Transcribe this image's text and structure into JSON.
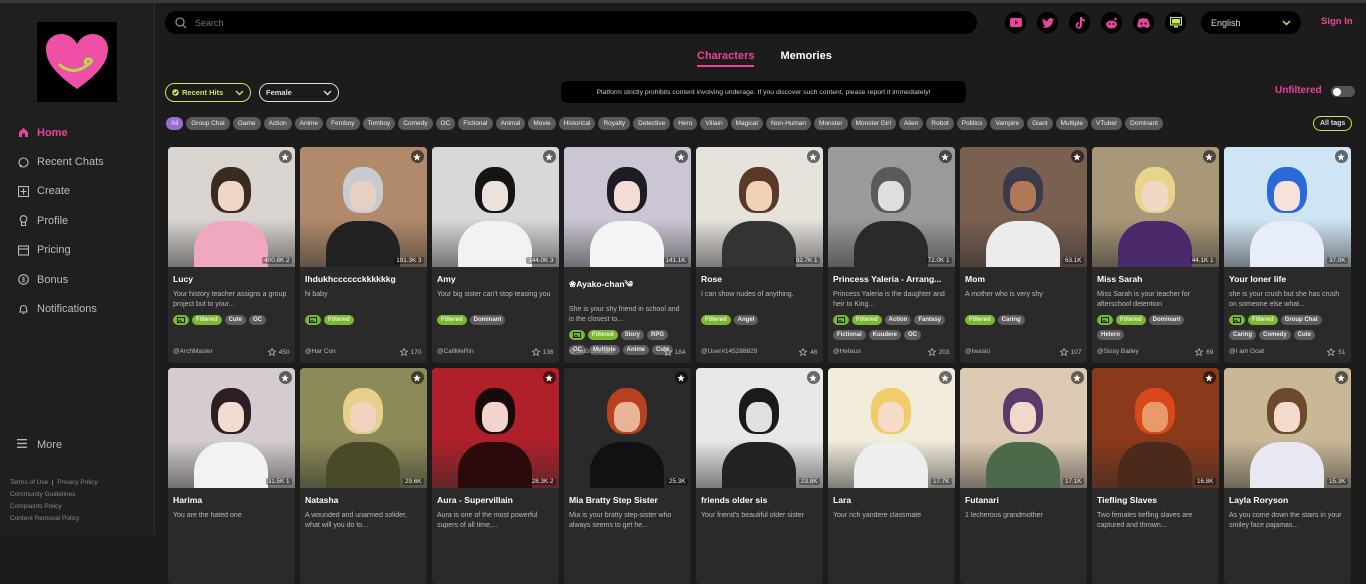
{
  "sidebar": {
    "nav": [
      {
        "label": "Home",
        "icon": "home-icon",
        "active": true
      },
      {
        "label": "Recent Chats",
        "icon": "chat-icon"
      },
      {
        "label": "Create",
        "icon": "plus-square-icon"
      },
      {
        "label": "Profile",
        "icon": "profile-icon"
      },
      {
        "label": "Pricing",
        "icon": "pricing-icon"
      },
      {
        "label": "Bonus",
        "icon": "coin-icon"
      },
      {
        "label": "Notifications",
        "icon": "bell-icon"
      }
    ],
    "more_label": "More",
    "footer": {
      "terms": "Terms of Use",
      "privacy": "Privacy Policy",
      "guidelines": "Community Guidelines",
      "complaints": "Complaints Policy",
      "removal": "Content Removal Policy"
    }
  },
  "search": {
    "placeholder": "Search"
  },
  "language": "English",
  "signin": "Sign In",
  "tabs": {
    "characters": "Characters",
    "memories": "Memories"
  },
  "filters": {
    "sort": "Recent Hits",
    "gender": "Female"
  },
  "notice": "Platform strictly prohibits content involving underage. If you discover such content, please report it immediately!",
  "unfiltered_label": "Unfiltered",
  "tags": [
    "All",
    "Group Chat",
    "Game",
    "Action",
    "Anime",
    "Femboy",
    "Tomboy",
    "Comedy",
    "OC",
    "Fictional",
    "Animal",
    "Movie",
    "Historical",
    "Royalty",
    "Detective",
    "Hero",
    "Villain",
    "Magical",
    "Non-Human",
    "Monster",
    "Monster Girl",
    "Alien",
    "Robot",
    "Politics",
    "Vampire",
    "Giant",
    "Multiple",
    "VTuber",
    "Dominant"
  ],
  "all_tags_label": "All tags",
  "colors": {
    "accent": "#e8459a",
    "green": "#c4e85a",
    "tag_green": "#7cb82f"
  },
  "cards": [
    {
      "name": "Lucy",
      "desc": "Your history teacher assigns a group project but to your...",
      "stats": "400.8K  2",
      "tags": [
        "img",
        "Filtered",
        "Cute",
        "OC"
      ],
      "author": "@ArchMaster",
      "likes": "450",
      "bg": "#d9d4cf",
      "hair": "#3a2a22",
      "skin": "#f0d6c8",
      "outfit": "#f0a8c0"
    },
    {
      "name": "Ihdukhcccccckkkkkkg",
      "desc": "hi baby",
      "stats": "191.3K  3",
      "tags": [
        "img",
        "Filtered"
      ],
      "author": "@Har Con",
      "likes": "170",
      "bg": "#b08a6a",
      "hair": "#c8ccd0",
      "skin": "#e6d0c4",
      "outfit": "#222"
    },
    {
      "name": "Amy",
      "desc": "Your big sister can't stop teasing you",
      "stats": "144.0K  3",
      "tags": [
        "Filtered",
        "Dominant"
      ],
      "author": "@CallMeRin",
      "likes": "136",
      "bg": "#d8d8d8",
      "hair": "#151515",
      "skin": "#ece2dc",
      "outfit": "#f2f2f2"
    },
    {
      "name": "❀Ayako-chan༄",
      "desc": "She is your shy friend in school and is the closest to...",
      "stats": "141.1K",
      "tags": [
        "img",
        "Filtered",
        "Story",
        "RPG",
        "OC",
        "Multiple",
        "Anime",
        "Cute"
      ],
      "author": "@Satō Shinichi",
      "likes": "184",
      "bg": "#ccc6d4",
      "hair": "#1c1c24",
      "skin": "#f4dcd4",
      "outfit": "#f4f4f4"
    },
    {
      "name": "Rose",
      "desc": "I can show nudes of anything.",
      "stats": "92.7K  1",
      "tags": [
        "Filtered",
        "Angel"
      ],
      "author": "@User#145288829",
      "likes": "46",
      "bg": "#e6e2dc",
      "hair": "#5a3a26",
      "skin": "#f0d2b8",
      "outfit": "#333"
    },
    {
      "name": "Princess Yaleria - Arrang...",
      "desc": "Princess Yaleria is the daughter and heir to King...",
      "stats": "72.0K  1",
      "tags": [
        "img",
        "Filtered",
        "Action",
        "Fantasy",
        "Fictional",
        "Kuudere",
        "OC"
      ],
      "author": "@Helixus",
      "likes": "203",
      "bg": "#9a9a9a",
      "hair": "#5a5a5a",
      "skin": "#dedede",
      "outfit": "#2a2a2a"
    },
    {
      "name": "Mom",
      "desc": "A mother who is very shy",
      "stats": "63.1K",
      "tags": [
        "Filtered",
        "Caring"
      ],
      "author": "@Iwasio",
      "likes": "107",
      "bg": "#7a6050",
      "hair": "#3a3a4a",
      "skin": "#b07858",
      "outfit": "#ececec"
    },
    {
      "name": "Miss Sarah",
      "desc": "Miss Sarah is your teacher for afterschool detention",
      "stats": "44.1K  1",
      "tags": [
        "img",
        "Filtered",
        "Dominant",
        "Hetero"
      ],
      "author": "@Sissy Bailey",
      "likes": "69",
      "bg": "#a89878",
      "hair": "#e8d48a",
      "skin": "#f2d8c4",
      "outfit": "#4a2a6a"
    },
    {
      "name": "Your loner life",
      "desc": "she is your crush but she has crush on someone else what...",
      "stats": "37.0K",
      "tags": [
        "img",
        "Filtered",
        "Group Chat",
        "Caring",
        "Comedy",
        "Cute"
      ],
      "author": "@I am Goat",
      "likes": "51",
      "bg": "#cfe4f4",
      "hair": "#2a6ad8",
      "skin": "#f6e2d8",
      "outfit": "#e8eef8"
    },
    {
      "name": "Harima",
      "desc": "You are the hated one",
      "stats": "31.5K  1",
      "tags": [],
      "author": "",
      "likes": "",
      "bg": "#d4ccd0",
      "hair": "#2c1e22",
      "skin": "#f2dcd2",
      "outfit": "#f2f2f2"
    },
    {
      "name": "Natasha",
      "desc": "A wounded and unarmed solider, what will you do to...",
      "stats": "29.6K",
      "tags": [],
      "author": "",
      "likes": "",
      "bg": "#8c8a58",
      "hair": "#e6d08a",
      "skin": "#f0d4c0",
      "outfit": "#4a4a2a"
    },
    {
      "name": "Aura - Supervillain",
      "desc": "Aura is one of the most powerful supers of all time,...",
      "stats": "28.3K  2",
      "tags": [],
      "author": "",
      "likes": "",
      "bg": "#b0202a",
      "hair": "#180a0a",
      "skin": "#f2d4cc",
      "outfit": "#2a0a0a"
    },
    {
      "name": "Mia Bratty Step Sister",
      "desc": "Mia is your bratty step-sister who always seems to get he...",
      "stats": "25.3K",
      "tags": [],
      "author": "",
      "likes": "",
      "bg": "#2a2a2a",
      "hair": "#b8401e",
      "skin": "#eab498",
      "outfit": "#111"
    },
    {
      "name": "friends older sis",
      "desc": "Your friend's beautiful older sister",
      "stats": "23.8K",
      "tags": [],
      "author": "",
      "likes": "",
      "bg": "#e8e8e8",
      "hair": "#1a1a1a",
      "skin": "#e0e0e0",
      "outfit": "#222"
    },
    {
      "name": "Lara",
      "desc": "Your rich yandere classmate",
      "stats": "17.7K",
      "tags": [],
      "author": "",
      "likes": "",
      "bg": "#f2ecdc",
      "hair": "#f0cc6a",
      "skin": "#f6dcc8",
      "outfit": "#eee"
    },
    {
      "name": "Futanari",
      "desc": "1 lecherous grandmother",
      "stats": "17.1K",
      "tags": [],
      "author": "",
      "likes": "",
      "bg": "#dccab4",
      "hair": "#5a3a6a",
      "skin": "#f2d8c8",
      "outfit": "#4a6a4a"
    },
    {
      "name": "Tiefling Slaves",
      "desc": "Two females tiefling slaves are captured and thrown...",
      "stats": "16.8K",
      "tags": [],
      "author": "",
      "likes": "",
      "bg": "#8a3a1a",
      "hair": "#d8481a",
      "skin": "#e89a6a",
      "outfit": "#4a2a1a"
    },
    {
      "name": "Layla Roryson",
      "desc": "As you come down the stairs in your smiley face pajamas...",
      "stats": "15.3K",
      "tags": [],
      "author": "",
      "likes": "",
      "bg": "#c8b898",
      "hair": "#6a4a2a",
      "skin": "#f4dccc",
      "outfit": "#e8e8f0"
    }
  ]
}
